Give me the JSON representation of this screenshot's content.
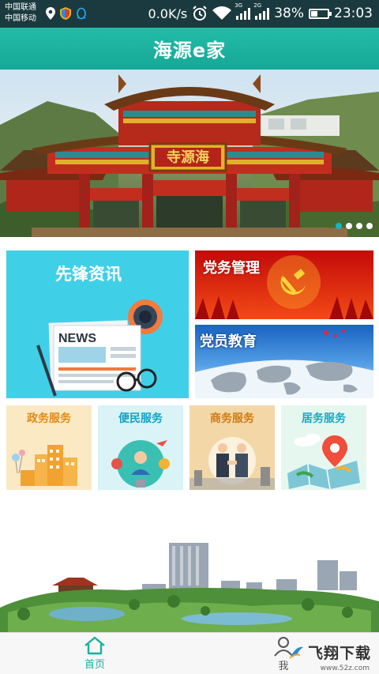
{
  "status_bar": {
    "carrier_1": "中国联通",
    "carrier_2": "中国移动",
    "net_speed": "0.0K/s",
    "sim1_type": "3G",
    "sim2_type": "2G",
    "battery": "38%",
    "battery_level": 0.38,
    "time": "23:03",
    "icons": [
      "location-icon",
      "shield-icon",
      "qq-icon",
      "alarm-icon",
      "wifi-icon",
      "signal-icon",
      "battery-icon"
    ]
  },
  "header": {
    "title": "海源e家"
  },
  "banner": {
    "plaque_text": "寺源海",
    "slide_count": 4,
    "active_slide": 1
  },
  "tiles": {
    "news": {
      "label": "先锋资讯",
      "badge_text": "NEWS"
    },
    "party": {
      "label": "党务管理"
    },
    "education": {
      "label": "党员教育"
    },
    "gov": {
      "label": "政务服务"
    },
    "people": {
      "label": "便民服务"
    },
    "business": {
      "label": "商务服务"
    },
    "home": {
      "label": "居务服务"
    }
  },
  "tab_bar": {
    "home_label": "首页",
    "me_label": "我"
  },
  "watermark": {
    "text": "飞翔下载",
    "url": "www.52z.com"
  },
  "colors": {
    "brand": "#1bb39f",
    "status_bar": "#1a3a3f",
    "news_tile": "#3fd0e8",
    "party_red": "#d61d10"
  }
}
